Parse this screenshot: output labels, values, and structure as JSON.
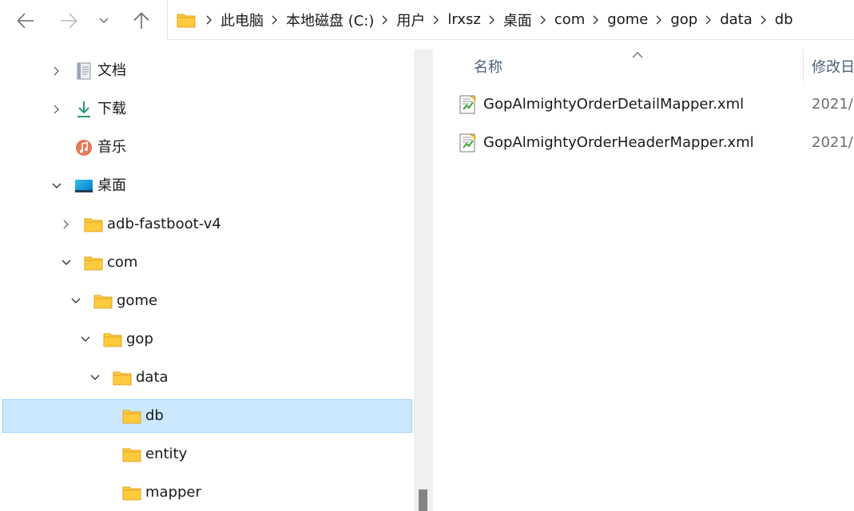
{
  "toolbar": {
    "back_icon": "arrow-left-icon",
    "forward_icon": "arrow-right-icon",
    "recent_icon": "chevron-down-icon",
    "up_icon": "arrow-up-icon"
  },
  "address_bar": {
    "crumbs": [
      "此电脑",
      "本地磁盘 (C:)",
      "用户",
      "lrxsz",
      "桌面",
      "com",
      "gome",
      "gop",
      "data",
      "db"
    ]
  },
  "tree": {
    "items": [
      {
        "label": "文档",
        "icon": "document-icon",
        "expanded": false
      },
      {
        "label": "下载",
        "icon": "download-icon",
        "expanded": false
      },
      {
        "label": "音乐",
        "icon": "music-icon",
        "expanded": null
      },
      {
        "label": "桌面",
        "icon": "desktop-icon",
        "expanded": true
      },
      {
        "label": "adb-fastboot-v4",
        "icon": "folder-icon",
        "expanded": false
      },
      {
        "label": "com",
        "icon": "folder-icon",
        "expanded": true
      },
      {
        "label": "gome",
        "icon": "folder-icon",
        "expanded": true
      },
      {
        "label": "gop",
        "icon": "folder-icon",
        "expanded": true
      },
      {
        "label": "data",
        "icon": "folder-icon",
        "expanded": true
      },
      {
        "label": "db",
        "icon": "folder-icon",
        "expanded": null,
        "selected": true
      },
      {
        "label": "entity",
        "icon": "folder-icon",
        "expanded": null
      },
      {
        "label": "mapper",
        "icon": "folder-icon",
        "expanded": null
      }
    ]
  },
  "file_list": {
    "columns": {
      "name": "名称",
      "date": "修改日"
    },
    "files": [
      {
        "name": "GopAlmightyOrderDetailMapper.xml",
        "date": "2021/",
        "icon": "xml-file-icon"
      },
      {
        "name": "GopAlmightyOrderHeaderMapper.xml",
        "date": "2021/",
        "icon": "xml-file-icon"
      }
    ]
  },
  "colors": {
    "selection_bg": "#cce8ff",
    "selection_border": "#99d1ff",
    "folder_yellow": "#ffcb3d",
    "header_text": "#4c607a"
  }
}
